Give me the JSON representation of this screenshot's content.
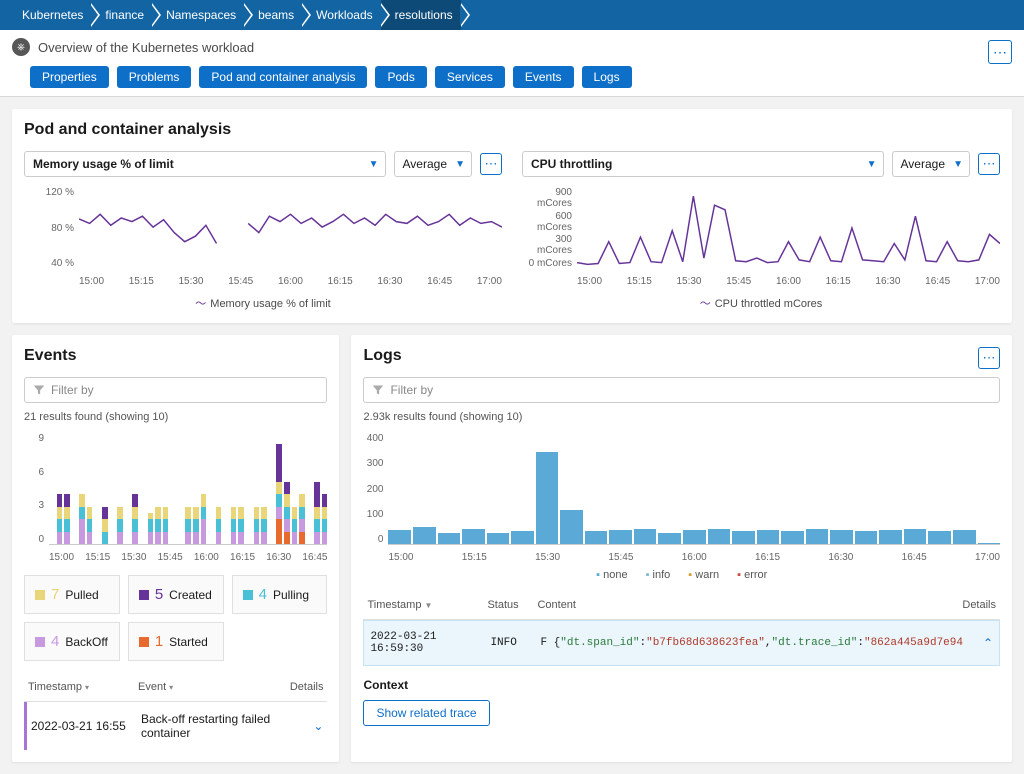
{
  "breadcrumb": [
    "Kubernetes",
    "finance",
    "Namespaces",
    "beams",
    "Workloads",
    "resolutions"
  ],
  "header": {
    "title": "Overview of the Kubernetes workload",
    "tabs": [
      "Properties",
      "Problems",
      "Pod and container analysis",
      "Pods",
      "Services",
      "Events",
      "Logs"
    ]
  },
  "analysis": {
    "title": "Pod and container analysis",
    "left": {
      "metric": "Memory usage % of limit",
      "agg": "Average",
      "legend": "Memory usage % of limit",
      "yticks": [
        "120 %",
        "80 %",
        "40 %"
      ]
    },
    "right": {
      "metric": "CPU throttling",
      "agg": "Average",
      "legend": "CPU throttled mCores",
      "yticks": [
        "900 mCores",
        "600 mCores",
        "300 mCores",
        "0 mCores"
      ]
    },
    "xticks": [
      "15:00",
      "15:15",
      "15:30",
      "15:45",
      "16:00",
      "16:15",
      "16:30",
      "16:45",
      "17:00"
    ]
  },
  "events": {
    "title": "Events",
    "filter_placeholder": "Filter by",
    "results": "21 results found (showing 10)",
    "yticks": [
      "9",
      "6",
      "3",
      "0"
    ],
    "xticks": [
      "15:00",
      "15:15",
      "15:30",
      "15:45",
      "16:00",
      "16:15",
      "16:30",
      "16:45"
    ],
    "categories": [
      {
        "count": "7",
        "label": "Pulled",
        "color": "#e9d57a"
      },
      {
        "count": "5",
        "label": "Created",
        "color": "#663399"
      },
      {
        "count": "4",
        "label": "Pulling",
        "color": "#4ac0d6"
      },
      {
        "count": "4",
        "label": "BackOff",
        "color": "#c79ae0"
      },
      {
        "count": "1",
        "label": "Started",
        "color": "#e86a2e"
      }
    ],
    "table": {
      "cols": [
        "Timestamp",
        "Event",
        "Details"
      ],
      "rows": [
        {
          "ts": "2022-03-21 16:55",
          "event": "Back-off restarting failed container"
        }
      ]
    }
  },
  "logs": {
    "title": "Logs",
    "filter_placeholder": "Filter by",
    "results": "2.93k results found (showing 10)",
    "yticks": [
      "400",
      "300",
      "200",
      "100",
      "0"
    ],
    "xticks": [
      "15:00",
      "15:15",
      "15:30",
      "15:45",
      "16:00",
      "16:15",
      "16:30",
      "16:45",
      "17:00"
    ],
    "legend": [
      "none",
      "info",
      "warn",
      "error"
    ],
    "table": {
      "cols": [
        "Timestamp",
        "Status",
        "Content",
        "Details"
      ],
      "row": {
        "ts": "2022-03-21 16:59:30",
        "status": "INFO",
        "prefix": "F {",
        "k1": "\"dt.span_id\"",
        "v1": "\"b7fb68d638623fea\"",
        "k2": "\"dt.trace_id\"",
        "v2": "\"862a445a9d7e94"
      }
    },
    "context": "Context",
    "trace_btn": "Show related trace"
  },
  "chart_data": [
    {
      "type": "line",
      "title": "Memory usage % of limit",
      "ylabel": "%",
      "ylim": [
        30,
        120
      ],
      "x": [
        "15:00",
        "15:03",
        "15:06",
        "15:09",
        "15:12",
        "15:15",
        "15:18",
        "15:21",
        "15:24",
        "15:27",
        "15:30",
        "15:33",
        "15:36",
        "15:39",
        "15:42",
        "15:45",
        "15:48",
        "15:51",
        "15:54",
        "15:57",
        "16:00",
        "16:03",
        "16:06",
        "16:09",
        "16:12",
        "16:15",
        "16:18",
        "16:21",
        "16:24",
        "16:27",
        "16:30",
        "16:33",
        "16:36",
        "16:39",
        "16:42",
        "16:45",
        "16:48",
        "16:51",
        "16:54",
        "16:57",
        "17:00"
      ],
      "series": [
        {
          "name": "Memory usage % of limit",
          "values": [
            85,
            80,
            90,
            78,
            86,
            82,
            88,
            76,
            84,
            70,
            60,
            66,
            78,
            58,
            null,
            null,
            80,
            70,
            88,
            82,
            90,
            80,
            86,
            76,
            82,
            90,
            80,
            86,
            78,
            90,
            82,
            80,
            88,
            78,
            82,
            90,
            78,
            86,
            80,
            82,
            76
          ]
        }
      ]
    },
    {
      "type": "line",
      "title": "CPU throttling",
      "ylabel": "mCores",
      "ylim": [
        0,
        900
      ],
      "x": [
        "15:00",
        "15:03",
        "15:06",
        "15:09",
        "15:12",
        "15:15",
        "15:18",
        "15:21",
        "15:24",
        "15:27",
        "15:30",
        "15:33",
        "15:36",
        "15:39",
        "15:42",
        "15:45",
        "15:48",
        "15:51",
        "15:54",
        "15:57",
        "16:00",
        "16:03",
        "16:06",
        "16:09",
        "16:12",
        "16:15",
        "16:18",
        "16:21",
        "16:24",
        "16:27",
        "16:30",
        "16:33",
        "16:36",
        "16:39",
        "16:42",
        "16:45",
        "16:48",
        "16:51",
        "16:54",
        "16:57",
        "17:00"
      ],
      "series": [
        {
          "name": "CPU throttled mCores",
          "values": [
            70,
            50,
            60,
            300,
            60,
            70,
            350,
            80,
            70,
            420,
            80,
            800,
            120,
            700,
            650,
            90,
            80,
            120,
            70,
            80,
            300,
            100,
            80,
            350,
            90,
            80,
            450,
            100,
            90,
            80,
            280,
            100,
            580,
            90,
            80,
            300,
            90,
            80,
            100,
            380,
            280
          ]
        }
      ]
    },
    {
      "type": "bar",
      "title": "Events",
      "ylim": [
        0,
        9
      ],
      "categories": [
        "15:00",
        "15:03",
        "15:06",
        "15:09",
        "15:12",
        "15:15",
        "15:18",
        "15:21",
        "15:24",
        "15:27",
        "15:30",
        "15:33",
        "15:36",
        "15:39",
        "15:42",
        "15:45",
        "15:48",
        "15:51",
        "15:54",
        "15:57",
        "16:00",
        "16:03",
        "16:06",
        "16:09",
        "16:12",
        "16:15",
        "16:18",
        "16:21",
        "16:24",
        "16:27",
        "16:30",
        "16:33",
        "16:36",
        "16:39",
        "16:42",
        "16:45",
        "16:48"
      ],
      "series": [
        {
          "name": "Pulled",
          "color": "#e9d57a",
          "values": [
            0,
            1,
            1,
            0,
            1,
            1,
            0,
            1,
            0,
            1,
            0,
            1,
            0,
            0.5,
            1,
            1,
            0,
            0,
            1,
            1,
            1,
            0,
            1,
            0,
            1,
            1,
            0,
            1,
            1,
            0,
            1,
            1,
            1,
            1,
            0,
            1,
            1
          ]
        },
        {
          "name": "Created",
          "color": "#663399",
          "values": [
            0,
            1,
            1,
            0,
            0,
            0,
            0,
            1,
            0,
            0,
            0,
            1,
            0,
            0,
            0,
            0,
            0,
            0,
            0,
            0,
            0,
            0,
            0,
            0,
            0,
            0,
            0,
            0,
            0,
            0,
            3,
            1,
            0,
            0,
            0,
            2,
            1
          ]
        },
        {
          "name": "Pulling",
          "color": "#4ac0d6",
          "values": [
            0,
            1,
            1,
            0,
            1,
            1,
            0,
            1,
            0,
            1,
            0,
            1,
            0,
            1,
            1,
            1,
            0,
            0,
            1,
            1,
            1,
            0,
            1,
            0,
            1,
            1,
            0,
            1,
            1,
            0,
            1,
            1,
            1,
            1,
            0,
            1,
            1
          ]
        },
        {
          "name": "BackOff",
          "color": "#c79ae0",
          "values": [
            0,
            1,
            1,
            0,
            2,
            1,
            0,
            0,
            0,
            1,
            0,
            1,
            0,
            1,
            1,
            1,
            0,
            0,
            1,
            1,
            2,
            0,
            1,
            0,
            1,
            1,
            0,
            1,
            1,
            0,
            1,
            1,
            1,
            1,
            0,
            1,
            1
          ]
        },
        {
          "name": "Started",
          "color": "#e86a2e",
          "values": [
            0,
            0,
            0,
            0,
            0,
            0,
            0,
            0,
            0,
            0,
            0,
            0,
            0,
            0,
            0,
            0,
            0,
            0,
            0,
            0,
            0,
            0,
            0,
            0,
            0,
            0,
            0,
            0,
            0,
            0,
            2,
            1,
            0,
            1,
            0,
            0,
            0
          ]
        }
      ]
    },
    {
      "type": "bar",
      "title": "Logs",
      "ylim": [
        0,
        400
      ],
      "categories": [
        "15:00",
        "15:05",
        "15:10",
        "15:15",
        "15:20",
        "15:25",
        "15:30",
        "15:35",
        "15:40",
        "15:45",
        "15:50",
        "15:55",
        "16:00",
        "16:05",
        "16:10",
        "16:15",
        "16:20",
        "16:25",
        "16:30",
        "16:35",
        "16:40",
        "16:45",
        "16:50",
        "16:55",
        "17:00"
      ],
      "series": [
        {
          "name": "none",
          "color": "#5aa9d6",
          "values": [
            50,
            60,
            40,
            55,
            40,
            45,
            330,
            120,
            45,
            50,
            55,
            40,
            50,
            55,
            45,
            50,
            45,
            55,
            50,
            45,
            50,
            55,
            45,
            50,
            5
          ]
        }
      ]
    }
  ]
}
